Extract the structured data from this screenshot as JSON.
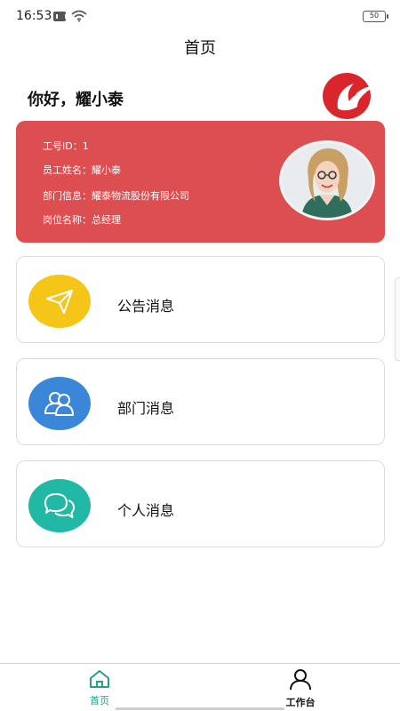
{
  "status_bar": {
    "time": "16:53",
    "battery": "50",
    "icons": [
      "message-icon",
      "wifi-icon",
      "battery-icon"
    ]
  },
  "header": {
    "title": "首页"
  },
  "greeting": "你好，耀小泰",
  "profile": {
    "rows": [
      {
        "label": "工号ID：",
        "value": "1"
      },
      {
        "label": "员工姓名：",
        "value": "耀小泰"
      },
      {
        "label": "部门信息：",
        "value": "耀泰物流股份有限公司"
      },
      {
        "label": "岗位名称：",
        "value": "总经理"
      }
    ],
    "card_color": "#dd4e51"
  },
  "messages": [
    {
      "label": "公告消息",
      "icon": "paper-plane-icon",
      "color": "#f5c518"
    },
    {
      "label": "部门消息",
      "icon": "group-users-icon",
      "color": "#3a86d8"
    },
    {
      "label": "个人消息",
      "icon": "chat-bubbles-icon",
      "color": "#22b8a6"
    }
  ],
  "bottom_nav": {
    "items": [
      {
        "label": "首页",
        "icon": "home-icon",
        "active": true
      },
      {
        "label": "工作台",
        "icon": "user-icon",
        "active": false
      }
    ],
    "active_color": "#2a9d8f"
  }
}
